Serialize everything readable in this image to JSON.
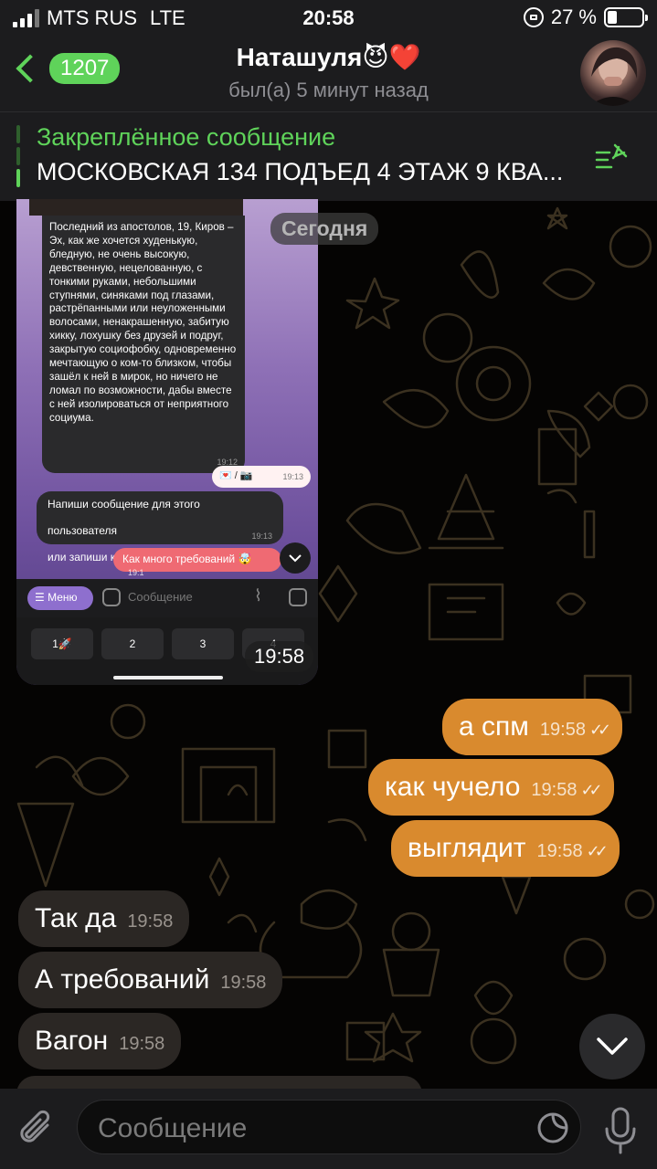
{
  "status_bar": {
    "carrier": "MTS RUS",
    "network": "LTE",
    "time": "20:58",
    "battery": "27 %",
    "battery_level_percent": 27
  },
  "header": {
    "back_count": "1207",
    "title": "Наташуля😈❤️",
    "subtitle": "был(а) 5 минут назад"
  },
  "pinned": {
    "title": "Закреплённое сообщение",
    "text": "МОСКОВСКАЯ 134 ПОДЪЕД 4 ЭТАЖ 9 КВА..."
  },
  "date_chip": "Сегодня",
  "image_message": {
    "time": "19:58",
    "screenshot": {
      "message_text": "Последний из апостолов, 19, Киров – Эх, как же хочется худенькую, бледную, не очень высокую, девственную, нецелованную, с тонкими руками, небольшими ступнями, синяками под глазами, растрёпанными или неуложенными волосами, ненакрашенную, забитую хикку, лохушку без друзей и подруг, закрытую социофобку, одновременно мечтающую о ком-то близком, чтобы зашёл к ней в мирок, но ничего не ломал по возможности, дабы вместе с ней изолироваться от неприятного социума.",
      "message_time": "19:12",
      "out1_text": "💌 / 📷",
      "out1_time": "19:13",
      "bot_text_1": "Напиши сообщение для этого пользователя",
      "bot_text_2": "или запиши короткое видео(до 15сек)",
      "bot_time": "19:13",
      "out2_text": "Как много требований 🤯",
      "out2_time": "19:1",
      "menu_label": "☰ Меню",
      "input_placeholder": "Сообщение",
      "keys": [
        "1🚀",
        "2",
        "3",
        "4"
      ]
    }
  },
  "messages": [
    {
      "dir": "out",
      "text": "а спм",
      "time": "19:58"
    },
    {
      "dir": "out",
      "text": "как чучело",
      "time": "19:58"
    },
    {
      "dir": "out",
      "text": "выглядит",
      "time": "19:58"
    },
    {
      "dir": "in",
      "text": "Так да",
      "time": "19:58"
    },
    {
      "dir": "in",
      "text": "А требований",
      "time": "19:58"
    },
    {
      "dir": "in",
      "text": "Вагон",
      "time": "19:58"
    }
  ],
  "input": {
    "placeholder": "Сообщение"
  },
  "colors": {
    "accent": "#5fd35a",
    "outgoing_bubble": "#d98a2e",
    "incoming_bubble": "#2b2724"
  }
}
